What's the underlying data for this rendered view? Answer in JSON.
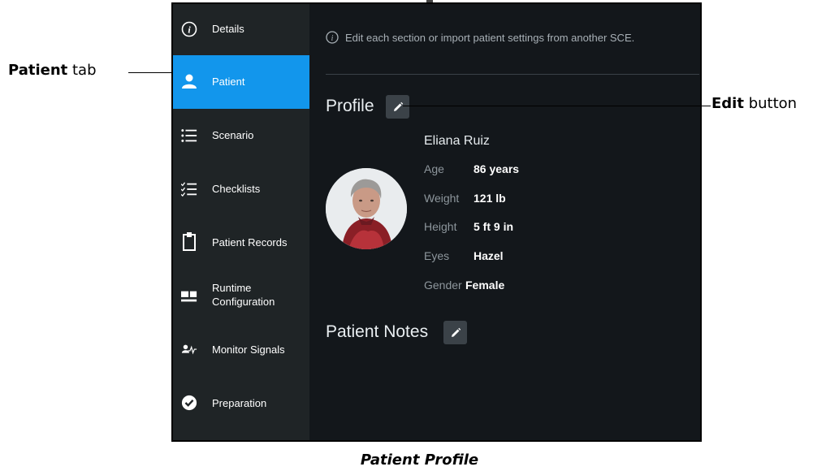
{
  "sidebar": {
    "items": [
      {
        "label": "Details",
        "icon": "info-icon"
      },
      {
        "label": "Patient",
        "icon": "person-icon",
        "active": true
      },
      {
        "label": "Scenario",
        "icon": "list-icon"
      },
      {
        "label": "Checklists",
        "icon": "checklist-icon"
      },
      {
        "label": "Patient Records",
        "icon": "clipboard-icon"
      },
      {
        "label": "Runtime",
        "label2": "Configuration",
        "icon": "layout-icon"
      },
      {
        "label": "Monitor Signals",
        "icon": "monitor-signal-icon"
      },
      {
        "label": "Preparation",
        "icon": "check-circle-icon"
      }
    ],
    "active_color": "#1296ec"
  },
  "main": {
    "info_text": "Edit each section or import patient settings from another SCE.",
    "profile_title": "Profile",
    "notes_title": "Patient Notes",
    "patient_name": "Eliana Ruiz",
    "fields": [
      {
        "label": "Age",
        "value": "86 years"
      },
      {
        "label": "Weight",
        "value": "121 lb"
      },
      {
        "label": "Height",
        "value": "5 ft 9 in"
      },
      {
        "label": "Eyes",
        "value": "Hazel"
      },
      {
        "label": "Gender",
        "value": "Female"
      }
    ]
  },
  "annotations": {
    "patient_tab_bold": "Patient",
    "patient_tab_rest": " tab",
    "edit_button_bold": "Edit",
    "edit_button_rest": " button",
    "caption": "Patient Profile"
  }
}
